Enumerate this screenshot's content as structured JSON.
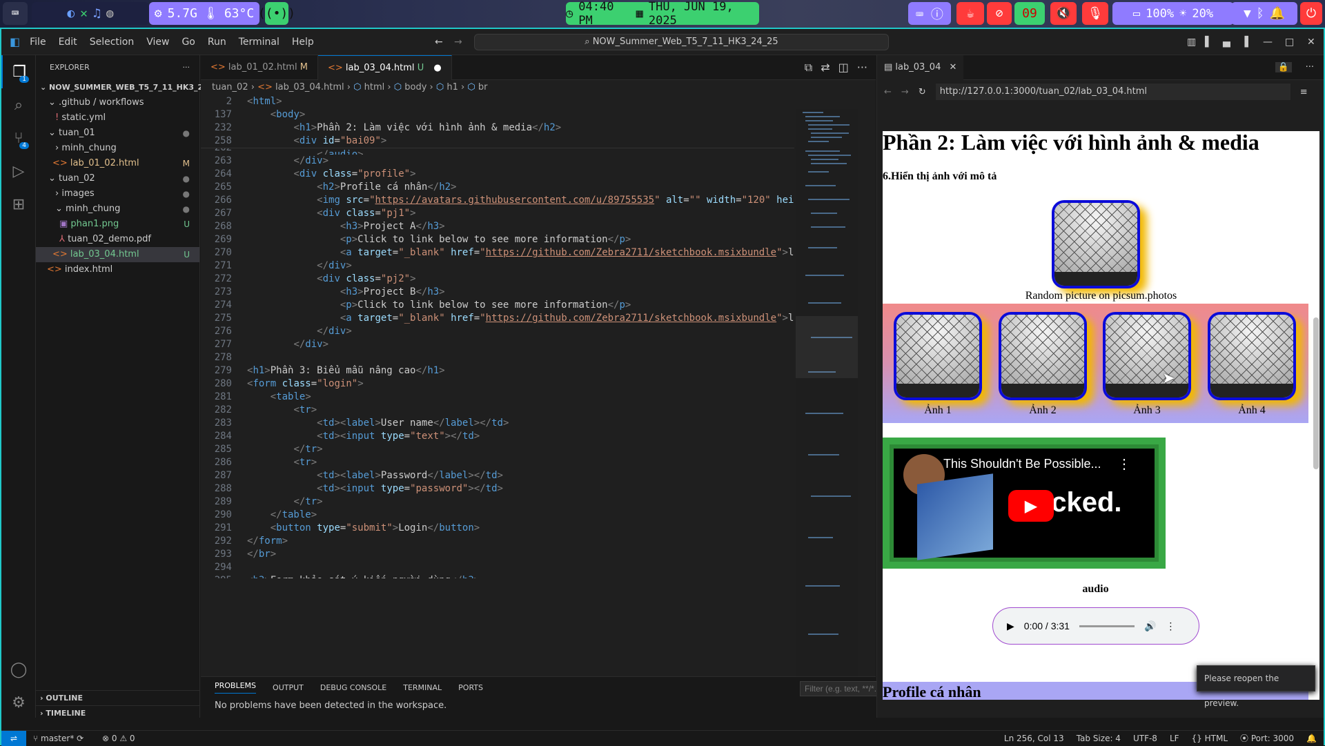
{
  "topbar": {
    "mem": "5.7G",
    "temp": "63°C",
    "clock": "04:40 PM",
    "date": "THU, JUN 19, 2025",
    "badge": "09",
    "battery": "100%",
    "brightness": "20%"
  },
  "window": {
    "menus": [
      "File",
      "Edit",
      "Selection",
      "View",
      "Go",
      "Run",
      "Terminal",
      "Help"
    ],
    "command_center": "NOW_Summer_Web_T5_7_11_HK3_24_25"
  },
  "activity": {
    "source_control_badge": "4",
    "explorer_badge": "1"
  },
  "explorer": {
    "title": "EXPLORER",
    "root": "NOW_SUMMER_WEB_T5_7_11_HK3_24_25",
    "items": [
      {
        "label": ".github / workflows",
        "badge": ""
      },
      {
        "label": "static.yml",
        "badge": ""
      },
      {
        "label": "tuan_01",
        "badge": "●"
      },
      {
        "label": "minh_chung",
        "badge": ""
      },
      {
        "label": "lab_01_02.html",
        "badge": "M"
      },
      {
        "label": "tuan_02",
        "badge": "●"
      },
      {
        "label": "images",
        "badge": "●"
      },
      {
        "label": "minh_chung",
        "badge": "●"
      },
      {
        "label": "phan1.png",
        "badge": "U"
      },
      {
        "label": "tuan_02_demo.pdf",
        "badge": ""
      },
      {
        "label": "lab_03_04.html",
        "badge": "U"
      },
      {
        "label": "index.html",
        "badge": ""
      }
    ],
    "outline": "OUTLINE",
    "timeline": "TIMELINE"
  },
  "tabs": [
    {
      "label": "lab_01_02.html",
      "badge": "M"
    },
    {
      "label": "lab_03_04.html",
      "badge": "U"
    }
  ],
  "breadcrumb": [
    "tuan_02",
    "lab_03_04.html",
    "html",
    "body",
    "h1",
    "br"
  ],
  "panel": {
    "tabs": [
      "PROBLEMS",
      "OUTPUT",
      "DEBUG CONSOLE",
      "TERMINAL",
      "PORTS"
    ],
    "message": "No problems have been detected in the workspace.",
    "filter_placeholder": "Filter (e.g. text, **/*.ts, !**/node_modules/**)"
  },
  "preview": {
    "tab": "lab_03_04",
    "url": "http://127.0.0.1:3000/tuan_02/lab_03_04.html",
    "heading": "Phần 2: Làm việc với hình ảnh & media",
    "subheading": "6.Hiển thị ảnh với mô tả",
    "caption": "Random picture on picsum.photos",
    "gallery": [
      "Ảnh 1",
      "Ảnh 2",
      "Ảnh 3",
      "Ảnh 4"
    ],
    "video_title": "This Shouldn't Be Possible...",
    "video_text": "acked.",
    "audio_label": "audio",
    "audio_time": "0:00 / 3:31",
    "profile_heading": "Profile cá nhân",
    "toast": "Please reopen the preview."
  },
  "status": {
    "branch": "master*",
    "errors": "0",
    "warnings": "0",
    "cursor": "Ln 256, Col 13",
    "tabsize": "Tab Size: 4",
    "encoding": "UTF-8",
    "eol": "LF",
    "lang": "HTML",
    "port": "Port: 3000"
  }
}
